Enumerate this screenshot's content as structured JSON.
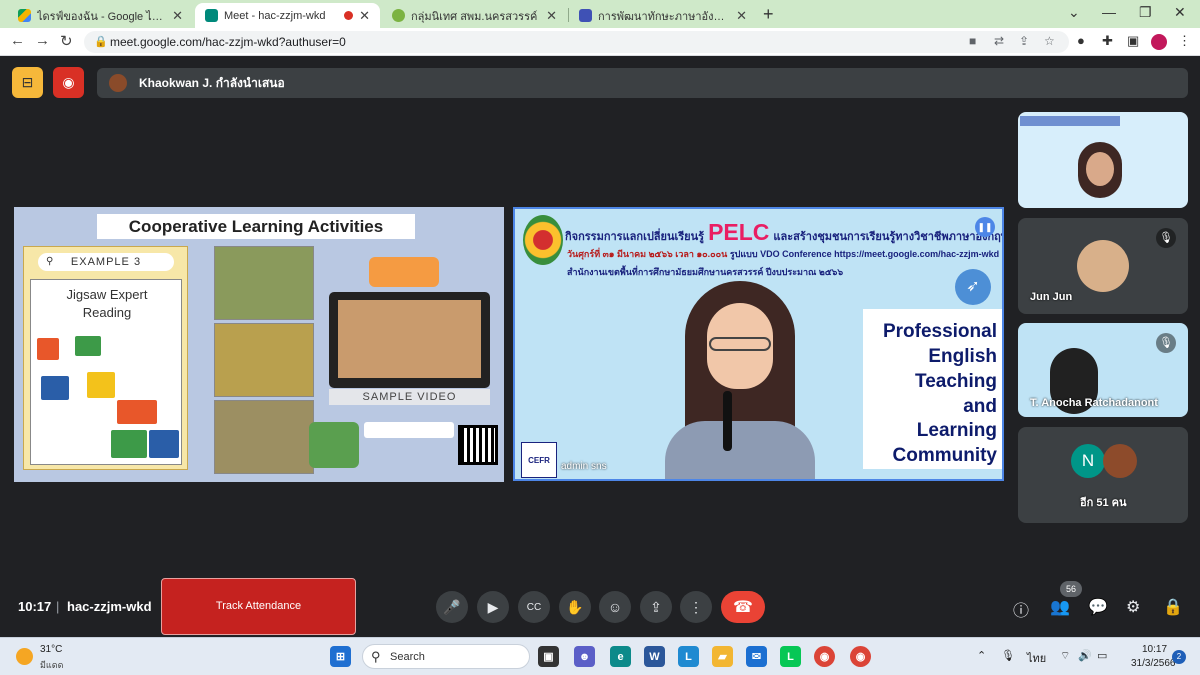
{
  "browser": {
    "tabs": [
      {
        "title": "ไดรฟ์ของฉัน - Google ไดรฟ์",
        "active": false
      },
      {
        "title": "Meet - hac-zzjm-wkd",
        "active": true
      },
      {
        "title": "กลุ่มนิเทศ สพม.นครสวรรค์",
        "active": false
      },
      {
        "title": "การพัฒนาทักษะภาษาอังกฤษ English",
        "active": false
      }
    ],
    "new_tab": "+",
    "url": "meet.google.com/hac-zzjm-wkd?authuser=0"
  },
  "meet": {
    "presenter_text": "Khaokwan J. กำลังนำเสนอ",
    "slide1": {
      "title": "Cooperative Learning Activities",
      "example": "EXAMPLE 3",
      "card_line1": "Jigsaw Expert",
      "card_line2": "Reading",
      "sample_video": "SAMPLE VIDEO"
    },
    "slide2": {
      "header_prefix": "กิจกรรมการแลกเปลี่ยนเรียนรู้",
      "pelc": "PELC",
      "header_suffix": "และสร้างชุมชนการเรียนรู้ทางวิชาชีพภาษาอังกฤษ",
      "date_line": "วันศุกร์ที่ ๓๑ มีนาคม ๒๕๖๖ เวลา ๑๐.๐๐น",
      "date_line_suffix": "รูปแบบ VDO Conference https://meet.google.com/hac-zzjm-wkd",
      "office_line": "สำนักงานเขตพื้นที่การศึกษามัธยมศึกษานครสวรรค์   ปีงบประมาณ ๒๕๖๖",
      "pet": [
        "Professional",
        "English",
        "Teaching",
        "and",
        "Learning",
        "Community"
      ],
      "cefr": "CEFR",
      "name": "admin sns"
    },
    "participants": [
      {
        "name": ""
      },
      {
        "name": "Jun Jun"
      },
      {
        "name": "T. Anocha Ratchadanont"
      },
      {
        "name": "อีก 51 คน",
        "initial": "N"
      }
    ],
    "time": "10:17",
    "separator": "|",
    "meeting_code": "hac-zzjm-wkd",
    "track_attendance": "Track Attendance",
    "people_count": "56"
  },
  "taskbar": {
    "temperature": "31°C",
    "condition": "มีแดด",
    "search": "Search",
    "lang": "ไทย",
    "clock_time": "10:17",
    "clock_date": "31/3/2566",
    "notification_count": "2"
  },
  "colors": {
    "tabbar": "#cfe9c9",
    "meet_bg": "#202124",
    "end_call": "#ea4335",
    "track_attendance": "#c5221f",
    "pelc_pink": "#e91e63"
  }
}
